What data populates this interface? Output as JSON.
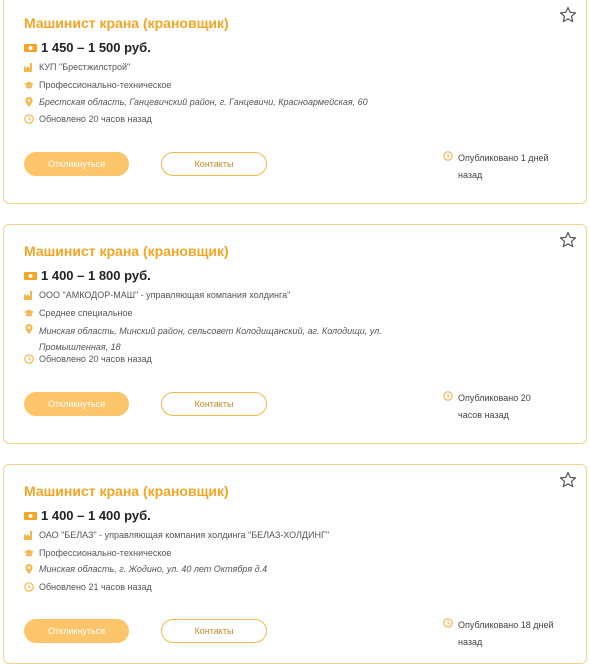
{
  "colors": {
    "accent": "#f5a523",
    "border": "#f3d48c",
    "button": "#fcc56a"
  },
  "icons": {
    "salary": "money-icon",
    "employer": "factory-icon",
    "education": "graduation-cap-icon",
    "location": "location-pin-icon",
    "updated": "clock-icon",
    "favorite": "star-icon"
  },
  "vacancies": [
    {
      "title": "Машинист крана (крановщик)",
      "salary": "1 450 – 1 500 руб.",
      "employer": "КУП \"Брестжилстрой\"",
      "education": "Профессионально-техническое",
      "address_line1": "Брестская область, Ганцевичский район, г. Ганцевичи, Красноармейская, 60",
      "address_line2": "",
      "updated": "Обновлено 20 часов назад",
      "apply_label": "Откликнуться",
      "contacts_label": "Контакты",
      "published_line1": "Опубликовано 1 дней",
      "published_line2": "назад"
    },
    {
      "title": "Машинист крана (крановщик)",
      "salary": "1 400 – 1 800 руб.",
      "employer": "ООО \"АМКОДОР-МАШ\" - управляющая компания холдинга\"",
      "education": "Среднее специальное",
      "address_line1": "Минская область, Минский район, сельсовет Колодищанский, аг. Колодищи, ул.",
      "address_line2": "Промышленная, 18",
      "updated": "Обновлено 20 часов назад",
      "apply_label": "Откликнуться",
      "contacts_label": "Контакты",
      "published_line1": "Опубликовано 20",
      "published_line2": "часов назад"
    },
    {
      "title": "Машинист крана (крановщик)",
      "salary": "1 400 – 1 400 руб.",
      "employer": "ОАО \"БЕЛАЗ\" - управляющая компания холдинга \"БЕЛАЗ-ХОЛДИНГ\"",
      "education": "Профессионально-техническое",
      "address_line1": "Минская область, г. Жодино, ул. 40 лет Октября д.4",
      "address_line2": "",
      "updated": "Обновлено 21 часов назад",
      "apply_label": "Откликнуться",
      "contacts_label": "Контакты",
      "published_line1": "Опубликовано 18 дней",
      "published_line2": "назад"
    }
  ]
}
